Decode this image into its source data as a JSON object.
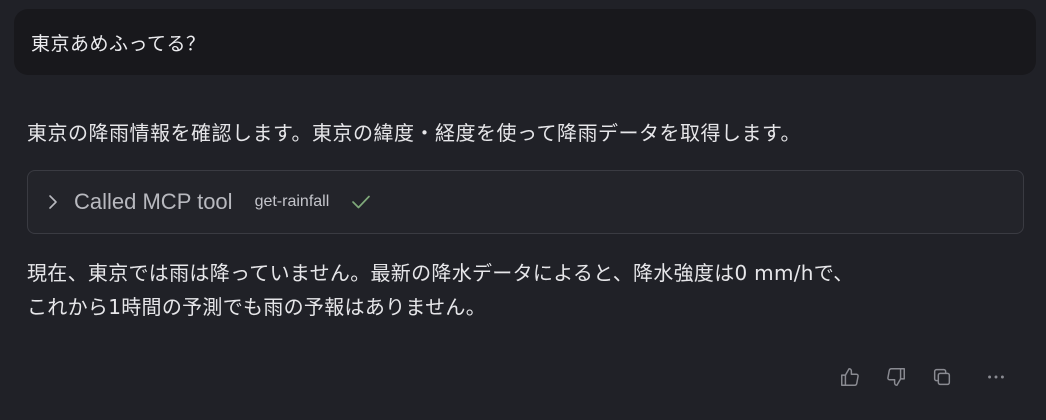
{
  "user_message": {
    "text": "東京あめふってる？"
  },
  "assistant": {
    "intro": "東京の降雨情報を確認します。東京の緯度・経度を使って降雨データを取得します。",
    "tool_call": {
      "label": "Called MCP tool",
      "tool_name": "get-rainfall",
      "status_icon": "check-icon",
      "expand_icon": "chevron-right-icon"
    },
    "answer_lines": [
      "現在、東京では雨は降っていません。最新の降水データによると、降水強度は0 mm/hで、",
      "これから1時間の予測でも雨の予報はありません。"
    ]
  },
  "actions": [
    {
      "name": "thumbs-up-icon"
    },
    {
      "name": "thumbs-down-icon"
    },
    {
      "name": "copy-icon"
    },
    {
      "name": "more-icon"
    }
  ],
  "colors": {
    "background": "#202127",
    "user_bubble": "#18181c",
    "tool_border": "#3a3b42",
    "check": "#7fa97a",
    "muted_icon": "#8a8b92"
  }
}
